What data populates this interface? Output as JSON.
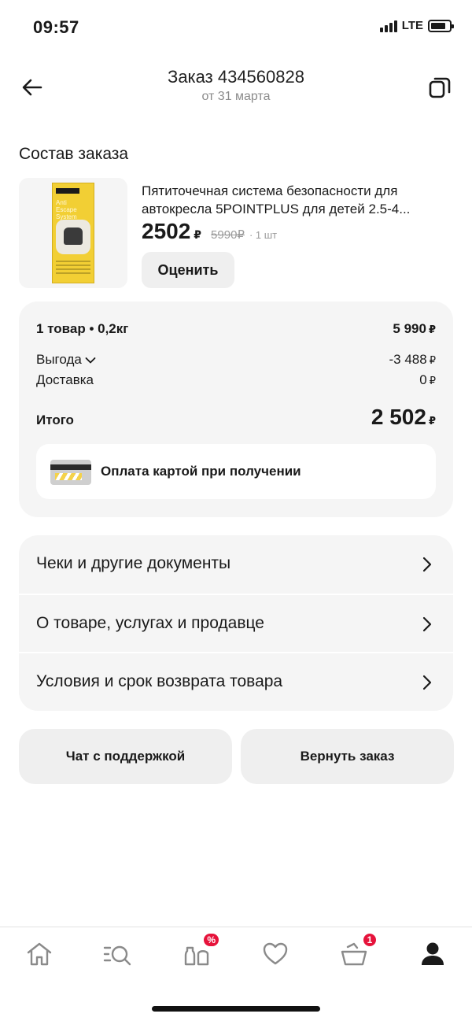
{
  "status_bar": {
    "time": "09:57",
    "network": "LTE"
  },
  "header": {
    "title": "Заказ 434560828",
    "subtitle": "от 31 марта",
    "back_icon": "arrow-left-icon",
    "copy_icon": "copy-icon"
  },
  "composition": {
    "title": "Состав заказа",
    "product": {
      "name": "Пятиточечная система безопасности для автокресла 5POINTPLUS для детей 2.5-4...",
      "price": "2502",
      "currency": "₽",
      "old_price": "5990₽",
      "quantity": "· 1 шт",
      "box_label": "Anti Escape System",
      "rate_label": "Оценить"
    }
  },
  "summary": {
    "items_label": "1 товар • 0,2кг",
    "items_value": "5 990",
    "benefit_label": "Выгода",
    "benefit_value": "-3 488",
    "delivery_label": "Доставка",
    "delivery_value": "0",
    "total_label": "Итого",
    "total_value": "2 502",
    "currency": "₽",
    "payment_label": "Оплата картой при получении"
  },
  "links": [
    {
      "label": "Чеки и другие документы"
    },
    {
      "label": "О товаре, услугах и продавце"
    },
    {
      "label": "Условия и срок возврата товара"
    }
  ],
  "actions": {
    "chat_label": "Чат с поддержкой",
    "return_label": "Вернуть заказ"
  },
  "tabbar": {
    "tabs": [
      {
        "icon": "home-icon"
      },
      {
        "icon": "catalog-search-icon"
      },
      {
        "icon": "discounts-icon",
        "badge": "%"
      },
      {
        "icon": "heart-icon"
      },
      {
        "icon": "cart-icon",
        "badge": "1"
      },
      {
        "icon": "profile-icon",
        "active": true
      }
    ]
  },
  "colors": {
    "badge": "#e6133b",
    "card_bg": "#f5f5f5",
    "button_bg": "#efefef",
    "muted_text": "#8b8b8b"
  }
}
